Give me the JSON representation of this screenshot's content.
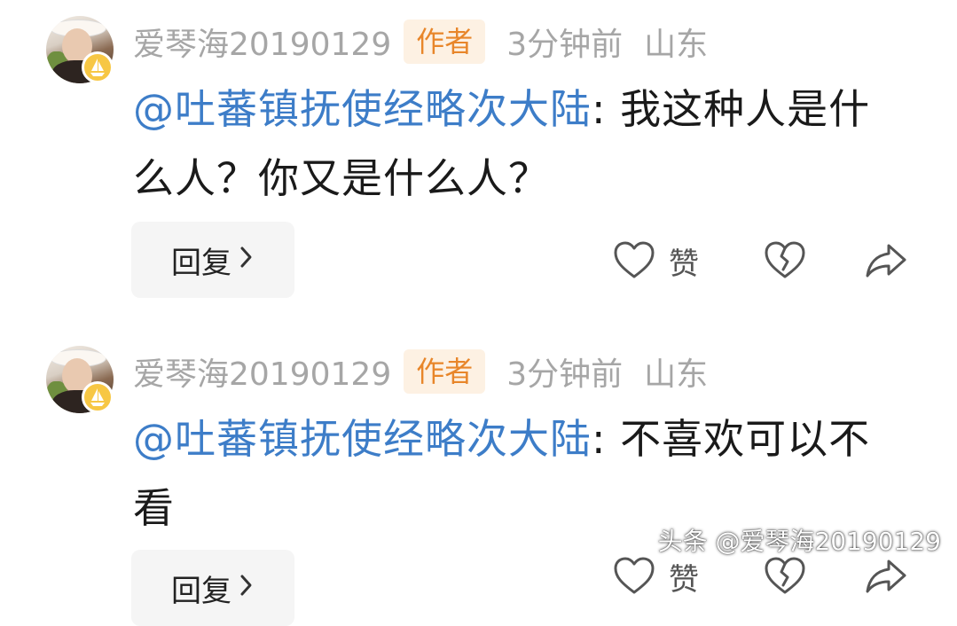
{
  "comments": [
    {
      "username": "爱琴海20190129",
      "author_tag": "作者",
      "time": "3分钟前",
      "location": "山东",
      "mention": "@吐蕃镇抚使经略次大陆",
      "text": ": 我这种人是什么人？你又是什么人？",
      "reply_label": "回复",
      "like_label": "赞"
    },
    {
      "username": "爱琴海20190129",
      "author_tag": "作者",
      "time": "3分钟前",
      "location": "山东",
      "mention": "@吐蕃镇抚使经略次大陆",
      "text": ": 不喜欢可以不看",
      "reply_label": "回复",
      "like_label": "赞"
    }
  ],
  "icons": {
    "avatar_badge": "boat-badge-icon",
    "like": "heart-icon",
    "dislike": "broken-heart-icon",
    "share": "share-arrow-icon",
    "reply_chevron": "chevron-right-icon"
  },
  "colors": {
    "mention": "#3d7dc8",
    "author_tag_text": "#e8862a",
    "author_tag_bg": "#fdf1e3",
    "meta_text": "#a6a6a6",
    "badge": "#f7c744"
  },
  "watermark": "头条 @爱琴海20190129"
}
